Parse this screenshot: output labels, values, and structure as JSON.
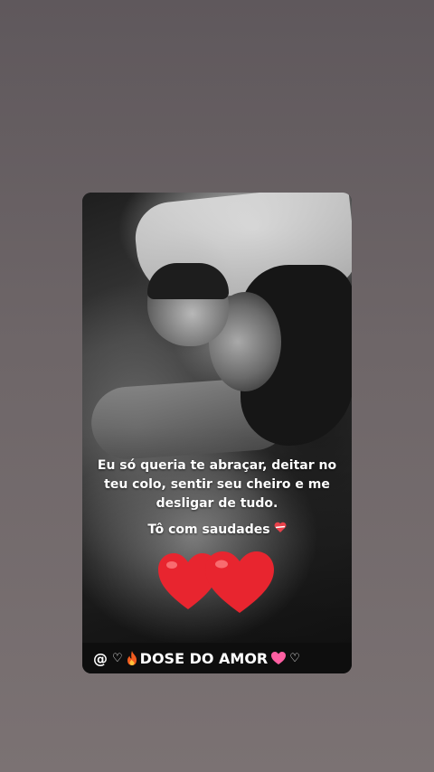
{
  "story": {
    "quote": "Eu só queria te abraçar, deitar no teu colo, sentir seu cheiro e me desligar de tudo.",
    "missing_text": "Tô com saudades",
    "missing_icon": "heart-ribbon-icon",
    "big_hearts_icon": "two-red-hearts-icon",
    "heart_color": "#e8252f",
    "caption": {
      "prefix": "@",
      "glyph_a": "",
      "heart_outline": "♡",
      "fire_icon": "fire-icon",
      "title": "DOSE DO AMOR",
      "pink_heart_icon": "pink-heart-icon",
      "trailing_heart": "♡",
      "glyph_b": ""
    }
  }
}
